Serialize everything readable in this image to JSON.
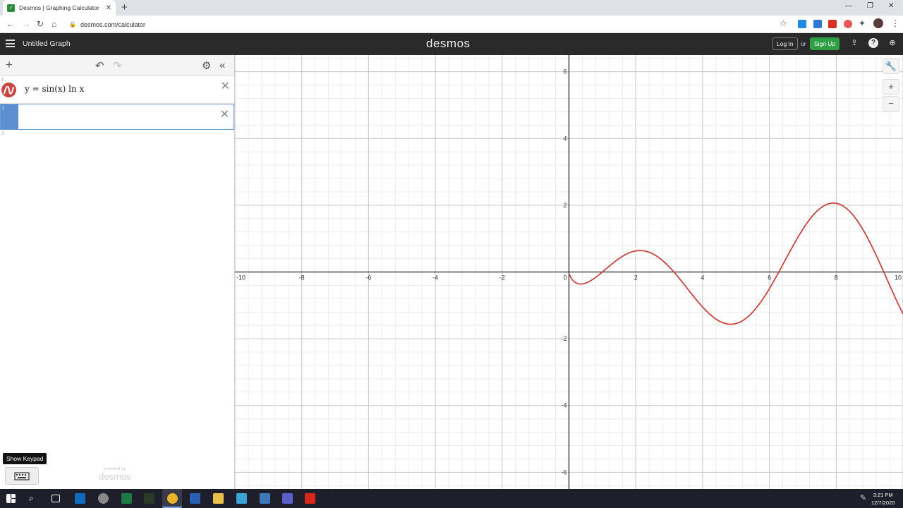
{
  "browser": {
    "tab_title": "Desmos | Graphing Calculator",
    "url": "desmos.com/calculator"
  },
  "header": {
    "graph_title": "Untitled Graph",
    "brand": "desmos",
    "login_label": "Log In",
    "or_label": "or",
    "signup_label": "Sign Up"
  },
  "expressions": [
    {
      "index": "1",
      "latex": "y = sin(x) ln x",
      "color": "#c74440"
    },
    {
      "index": "2",
      "latex": ""
    },
    {
      "index": "3",
      "latex": ""
    }
  ],
  "panel": {
    "powered_small": "powered by",
    "powered_brand": "desmos",
    "keypad_tooltip": "Show Keypad"
  },
  "graph": {
    "x_range": [
      -10,
      10
    ],
    "y_range": [
      -6.5,
      6.5
    ],
    "x_tick_labels": [
      "-10",
      "-8",
      "-6",
      "-4",
      "-2",
      "0",
      "2",
      "4",
      "6",
      "8",
      "10"
    ],
    "y_tick_labels": [
      "6",
      "4",
      "2",
      "-2",
      "-4",
      "-6"
    ],
    "curve_color": "#c74440"
  },
  "taskbar": {
    "time": "3:21 PM",
    "date": "12/7/2020"
  }
}
